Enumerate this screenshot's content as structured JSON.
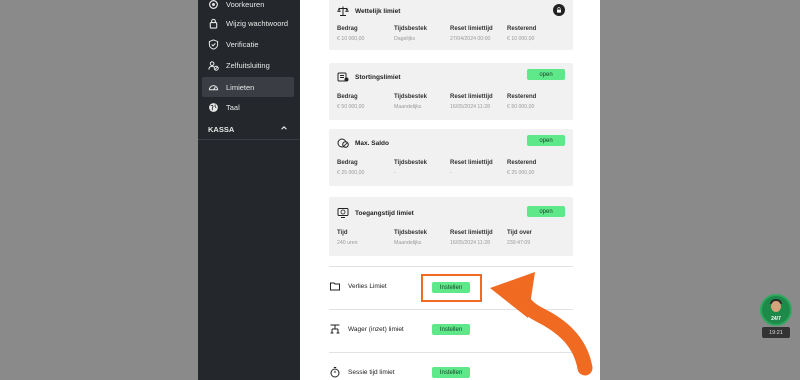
{
  "sidebar": {
    "items": [
      {
        "label": "Voorkeuren",
        "icon": "gear-icon"
      },
      {
        "label": "Wijzig wachtwoord",
        "icon": "lock-icon"
      },
      {
        "label": "Verificatie",
        "icon": "shield-icon"
      },
      {
        "label": "Zelfuitsluiting",
        "icon": "block-user-icon"
      },
      {
        "label": "Limieten",
        "icon": "gauge-icon",
        "active": true
      },
      {
        "label": "Taal",
        "icon": "globe-icon"
      }
    ],
    "section": "KASSA"
  },
  "cards": [
    {
      "title": "Wettelijk limiet",
      "icon": "scale-icon",
      "status": "locked",
      "columns": [
        {
          "header": "Bedrag",
          "value": "€ 10 000,00"
        },
        {
          "header": "Tijdsbestek",
          "value": "Dagelijks"
        },
        {
          "header": "Reset limiettijd",
          "value": "27/04/2024 00:00"
        },
        {
          "header": "Resterend",
          "value": "€ 10 000,00"
        }
      ]
    },
    {
      "title": "Stortingslimiet",
      "icon": "deposit-icon",
      "status": "open",
      "columns": [
        {
          "header": "Bedrag",
          "value": "€ 50 000,00"
        },
        {
          "header": "Tijdsbestek",
          "value": "Maandelijks"
        },
        {
          "header": "Reset limiettijd",
          "value": "16/05/2024 11:28"
        },
        {
          "header": "Resterend",
          "value": "€ 50 000,00"
        }
      ]
    },
    {
      "title": "Max. Saldo",
      "icon": "coins-icon",
      "status": "open",
      "columns": [
        {
          "header": "Bedrag",
          "value": "€ 25 000,00"
        },
        {
          "header": "Tijdsbestek",
          "value": "-"
        },
        {
          "header": "Reset limiettijd",
          "value": "-"
        },
        {
          "header": "Resterend",
          "value": "€ 25 000,00"
        }
      ]
    },
    {
      "title": "Toegangstijd limiet",
      "icon": "monitor-clock-icon",
      "status": "open",
      "columns": [
        {
          "header": "Tijd",
          "value": "240 uren"
        },
        {
          "header": "Tijdsbestek",
          "value": "Maandelijks"
        },
        {
          "header": "Reset limiettijd",
          "value": "16/05/2024 11:28"
        },
        {
          "header": "Tijd over",
          "value": "239:47:09"
        }
      ]
    }
  ],
  "limit_rows": [
    {
      "label": "Verlies Limiet",
      "icon": "wallet-icon",
      "button": "Instellen"
    },
    {
      "label": "Wager (inzet) limiet",
      "icon": "wager-icon",
      "button": "Instellen"
    },
    {
      "label": "Sessie tijd limiet",
      "icon": "stopwatch-icon",
      "button": "Instellen"
    }
  ],
  "open_label": "open",
  "chat": {
    "label": "24/7",
    "time": "19:21"
  },
  "colors": {
    "accent_green": "#5ee88a",
    "highlight_orange": "#f06a22",
    "sidebar": "#24272b"
  }
}
